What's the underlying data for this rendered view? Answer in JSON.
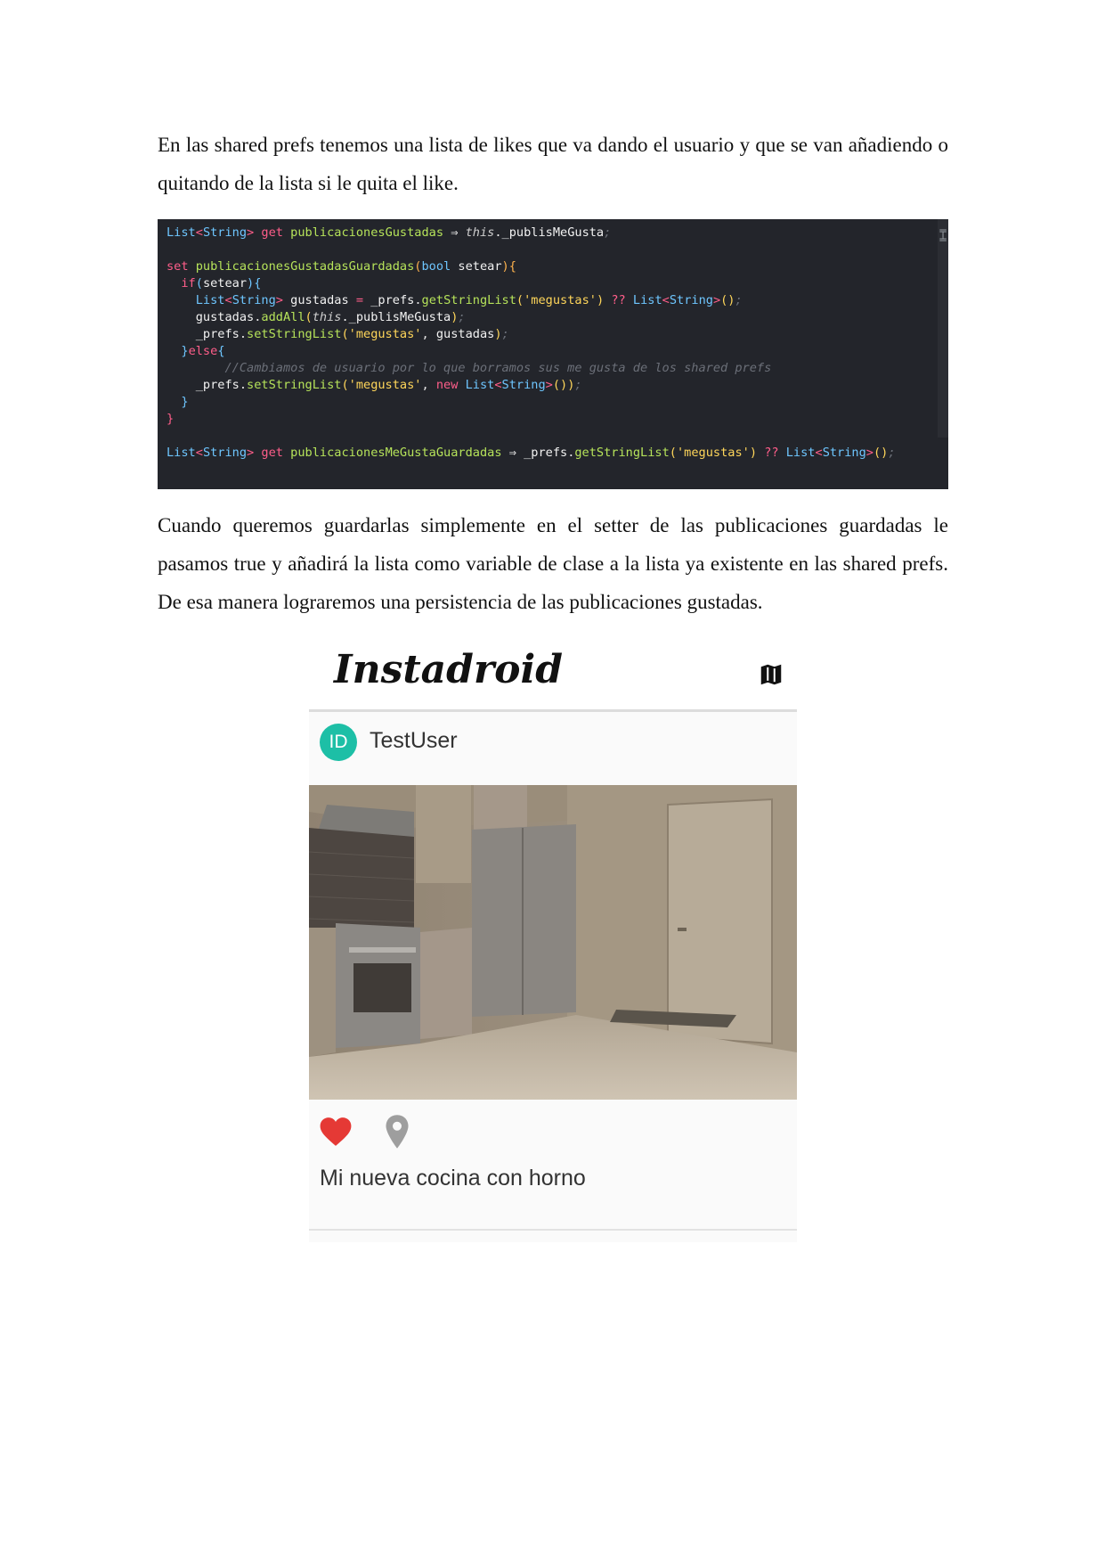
{
  "paragraphs": {
    "first": "En las shared prefs tenemos una lista de likes que va dando el usuario y que se van añadiendo o quitando de la lista si le quita el like.",
    "second": "Cuando queremos guardarlas simplemente en el setter de las publicaciones guardadas le pasamos true y añadirá la lista como variable de clase a la lista ya existente en las shared prefs. De esa manera lograremos una persistencia de las publicaciones gustadas."
  },
  "code": {
    "lines": [
      "List<String> get publicacionesGustadas ⇒ this._publisMeGusta;",
      "",
      "set publicacionesGustadasGuardadas(bool setear){",
      "  if(setear){",
      "    List<String> gustadas = _prefs.getStringList('megustas') ?? List<String>();",
      "    gustadas.addAll(this._publisMeGusta);",
      "    _prefs.setStringList('megustas', gustadas);",
      "  }else{",
      "    //Cambiamos de usuario por lo que borramos sus me gusta de los shared prefs",
      "    _prefs.setStringList('megustas', new List<String>());",
      "  }",
      "}",
      "",
      "List<String> get publicacionesMeGustaGuardadas ⇒ _prefs.getStringList('megustas') ?? List<String>();"
    ]
  },
  "app": {
    "logo": "Instadroid",
    "avatar_initials": "ID",
    "username": "TestUser",
    "caption": "Mi nueva cocina con horno",
    "icons": [
      "map-icon",
      "heart-icon",
      "location-pin-icon"
    ],
    "colors": {
      "avatar": "#1dbfa6",
      "heart": "#e53935",
      "pin": "#9e9e9e"
    }
  }
}
